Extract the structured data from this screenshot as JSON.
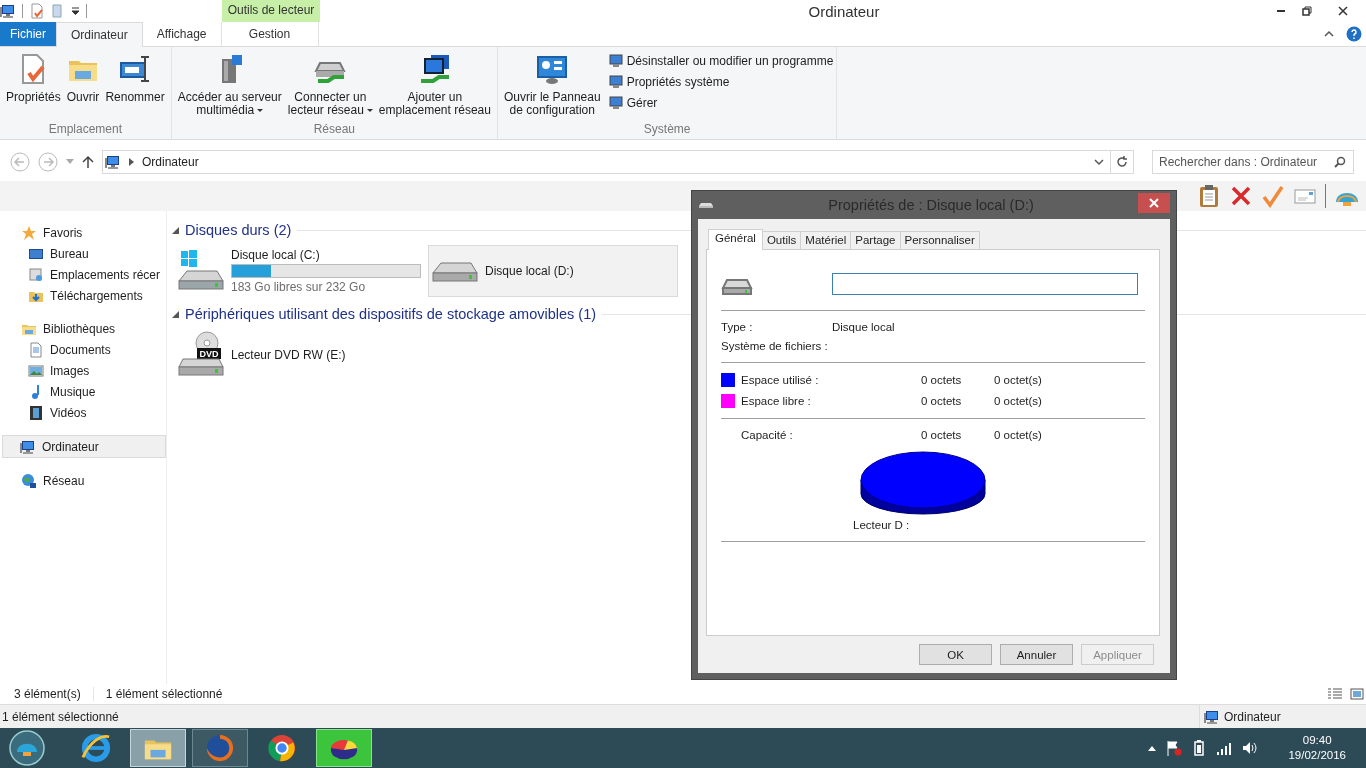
{
  "window": {
    "title": "Ordinateur"
  },
  "ribbon": {
    "context_tab": "Outils de lecteur",
    "tabs": [
      {
        "label": "Fichier",
        "kind": "file",
        "selected": false
      },
      {
        "label": "Ordinateur",
        "kind": "tab",
        "selected": true
      },
      {
        "label": "Affichage",
        "kind": "tab",
        "selected": false
      },
      {
        "label": "Gestion",
        "kind": "context",
        "selected": false
      }
    ],
    "groups": [
      {
        "label": "Emplacement",
        "buttons": [
          {
            "lines": [
              "Propriétés"
            ],
            "dropdown": false
          },
          {
            "lines": [
              "Ouvrir"
            ],
            "dropdown": false
          },
          {
            "lines": [
              "Renommer"
            ],
            "dropdown": false
          }
        ]
      },
      {
        "label": "Réseau",
        "buttons": [
          {
            "lines": [
              "Accéder au serveur",
              "multimédia"
            ],
            "dropdown": true
          },
          {
            "lines": [
              "Connecter un",
              "lecteur réseau"
            ],
            "dropdown": true
          },
          {
            "lines": [
              "Ajouter un",
              "emplacement réseau"
            ],
            "dropdown": false
          }
        ]
      },
      {
        "label": "Système",
        "buttons": [
          {
            "lines": [
              "Ouvrir le Panneau",
              "de configuration"
            ],
            "dropdown": false
          }
        ],
        "small_buttons": [
          "Désinstaller ou modifier un programme",
          "Propriétés système",
          "Gérer"
        ]
      }
    ]
  },
  "address_bar": {
    "path": "Ordinateur",
    "search_placeholder": "Rechercher dans : Ordinateur"
  },
  "navigation": [
    {
      "label": "Favoris",
      "selected": false,
      "children": [
        {
          "label": "Bureau",
          "selected": false
        },
        {
          "label": "Emplacements récer",
          "selected": false
        },
        {
          "label": "Téléchargements",
          "selected": false
        }
      ]
    },
    {
      "label": "Bibliothèques",
      "selected": false,
      "children": [
        {
          "label": "Documents",
          "selected": false
        },
        {
          "label": "Images",
          "selected": false
        },
        {
          "label": "Musique",
          "selected": false
        },
        {
          "label": "Vidéos",
          "selected": false
        }
      ]
    },
    {
      "label": "Ordinateur",
      "selected": true
    },
    {
      "label": "Réseau",
      "selected": false
    }
  ],
  "sections": [
    {
      "title": "Disques durs (2)",
      "items": [
        {
          "kind": "bar",
          "name": "Disque local (C:)",
          "level": 0.21,
          "detail": "183 Go libres sur 232 Go",
          "selected": false
        },
        {
          "kind": "drive",
          "name": "Disque local (D:)",
          "selected": true
        }
      ]
    },
    {
      "title": "Périphériques utilisant des dispositifs de stockage amovibles (1)",
      "items": [
        {
          "kind": "dvd",
          "name": "Lecteur DVD RW (E:)",
          "badge": "DVD",
          "selected": false
        }
      ]
    }
  ],
  "status_bar": {
    "count": "3 élément(s)",
    "selection": "1 élément sélectionné"
  },
  "details_bar": {
    "text": "1 élément sélectionné",
    "location": "Ordinateur"
  },
  "dialog": {
    "title": "Propriétés de : Disque local (D:)",
    "tabs": [
      {
        "label": "Général",
        "selected": true
      },
      {
        "label": "Outils",
        "selected": false
      },
      {
        "label": "Matériel",
        "selected": false
      },
      {
        "label": "Partage",
        "selected": false
      },
      {
        "label": "Personnaliser",
        "selected": false
      }
    ],
    "fields": [
      {
        "label": "Type :",
        "value": "Disque local"
      },
      {
        "label": "Système de fichiers :"
      }
    ],
    "usage": [
      {
        "label": "Espace utilisé :",
        "color": "#0000ff",
        "bytes": "0 octets",
        "size": "0 octet(s)"
      },
      {
        "label": "Espace libre :",
        "color": "#ff00ff",
        "bytes": "0 octets",
        "size": "0 octet(s)"
      }
    ],
    "capacity": {
      "label": "Capacité :",
      "bytes": "0 octets",
      "size": "0 octet(s)"
    },
    "drive_label": "Lecteur D :",
    "buttons": [
      {
        "label": "OK",
        "disabled": false
      },
      {
        "label": "Annuler",
        "disabled": false
      },
      {
        "label": "Appliquer",
        "disabled": true
      }
    ]
  },
  "taskbar": {
    "apps": [
      {
        "running": false,
        "selected": false
      },
      {
        "running": true,
        "selected": false
      },
      {
        "running": true,
        "selected": false
      },
      {
        "running": false,
        "selected": false
      },
      {
        "running": true,
        "selected": true
      }
    ]
  },
  "clock": {
    "time": "09:40",
    "date": "19/02/2016"
  }
}
